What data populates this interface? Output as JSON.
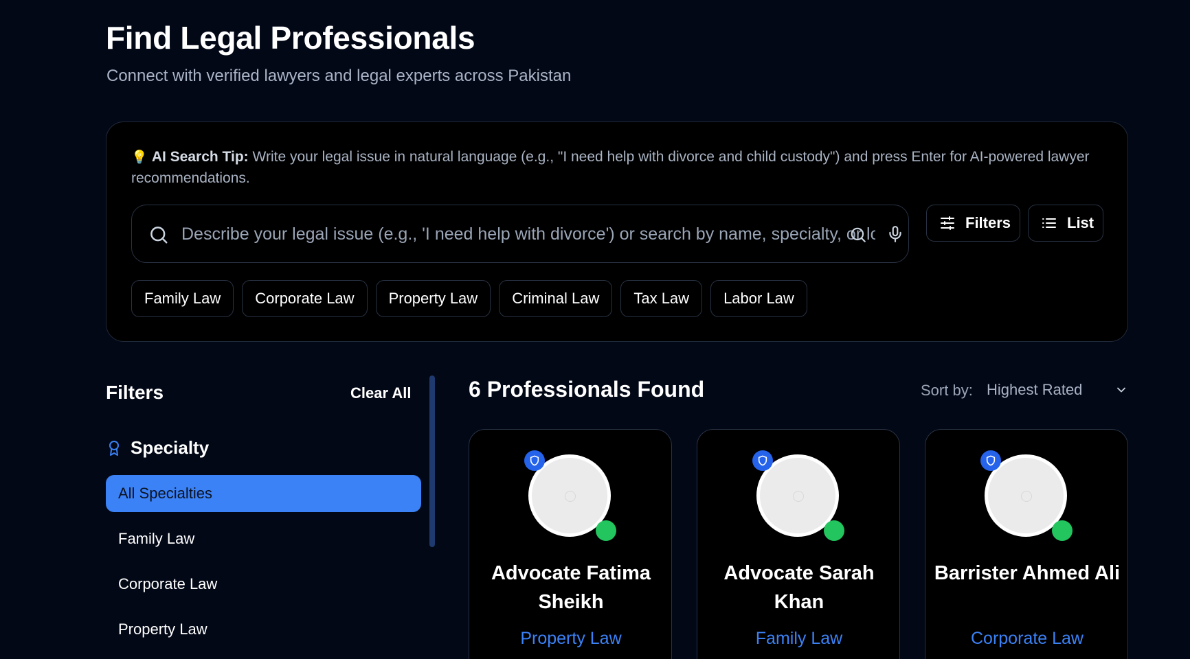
{
  "header": {
    "title": "Find Legal Professionals",
    "subtitle": "Connect with verified lawyers and legal experts across Pakistan"
  },
  "ai_tip": {
    "icon": "lightbulb-icon",
    "label": "AI Search Tip:",
    "text": " Write your legal issue in natural language (e.g., \"I need help with divorce and child custody\") and press Enter for AI-powered lawyer recommendations."
  },
  "search": {
    "placeholder": "Describe your legal issue (e.g., 'I need help with divorce') or search by name, specialty, or location",
    "value": ""
  },
  "toolbar": {
    "filters_label": "Filters",
    "list_label": "List"
  },
  "quick_filters": [
    "Family Law",
    "Corporate Law",
    "Property Law",
    "Criminal Law",
    "Tax Law",
    "Labor Law"
  ],
  "sidebar": {
    "title": "Filters",
    "clear_label": "Clear All",
    "section_title": "Specialty",
    "items": [
      {
        "label": "All Specialties",
        "active": true
      },
      {
        "label": "Family Law",
        "active": false
      },
      {
        "label": "Corporate Law",
        "active": false
      },
      {
        "label": "Property Law",
        "active": false
      }
    ]
  },
  "results": {
    "count_text": "6 Professionals Found",
    "sort_label": "Sort by:",
    "sort_value": "Highest Rated",
    "cards": [
      {
        "name": "Advocate Fatima Sheikh",
        "specialty": "Property Law"
      },
      {
        "name": "Advocate Sarah Khan",
        "specialty": "Family Law"
      },
      {
        "name": "Barrister Ahmed Ali",
        "specialty": "Corporate Law"
      }
    ]
  },
  "colors": {
    "background": "#030817",
    "accent": "#3b82f6",
    "online": "#22c55e",
    "verified": "#2563eb"
  }
}
